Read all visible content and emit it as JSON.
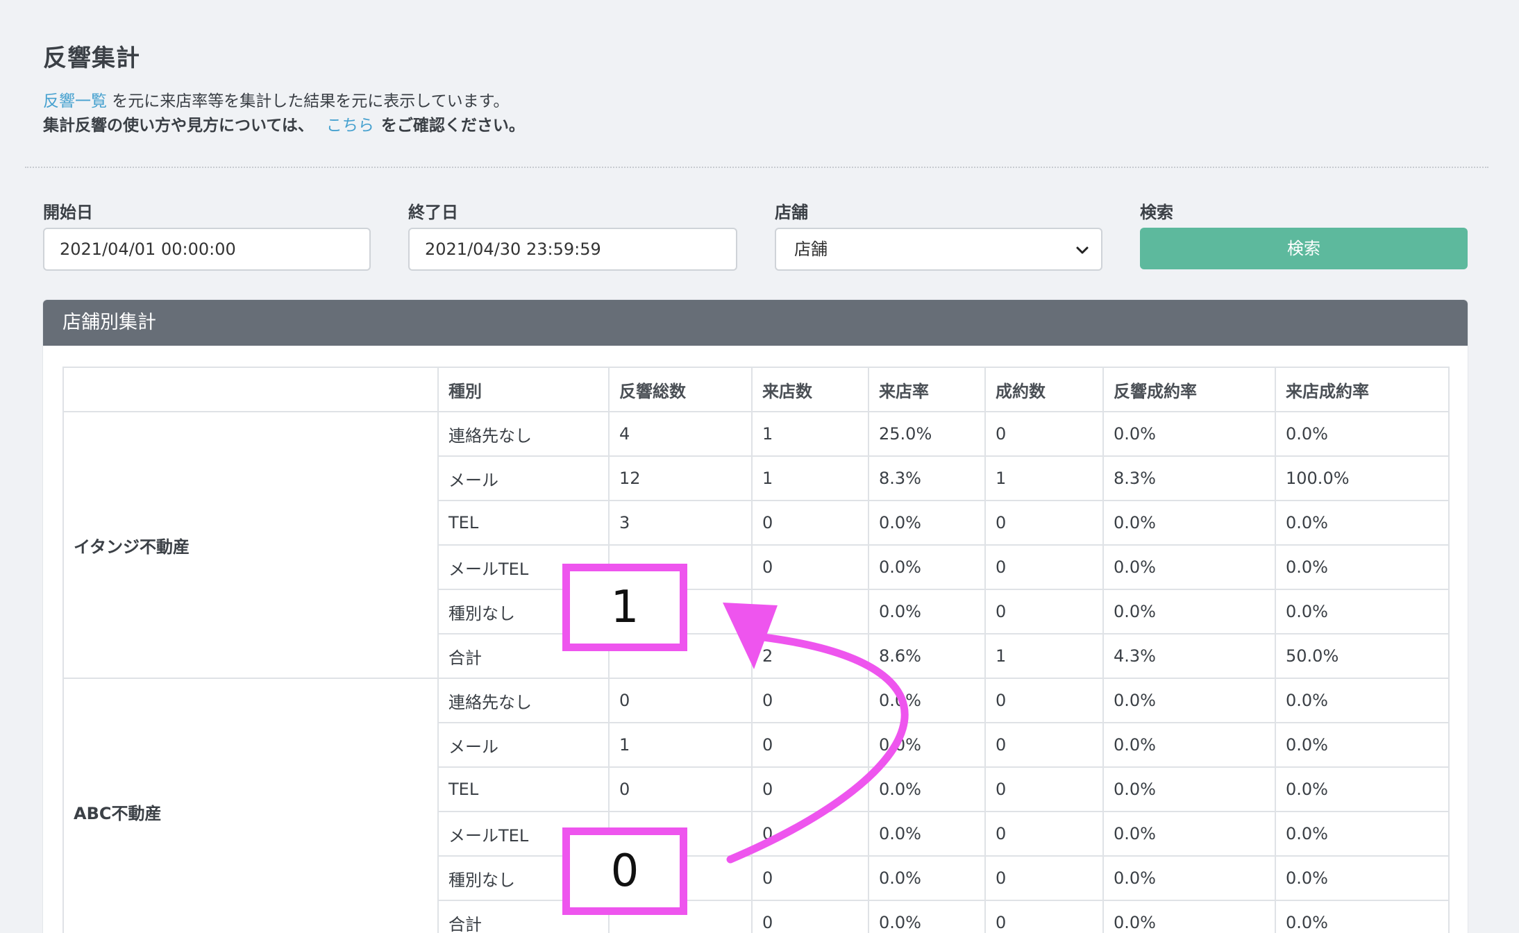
{
  "page_title": "反響集計",
  "description": {
    "link1": "反響一覧",
    "text1": " を元に来店率等を集計した結果を元に表示しています。",
    "text2_before": "集計反響の使い方や見方については、",
    "link2": "こちら",
    "text2_after": "をご確認ください。"
  },
  "filters": {
    "start_label": "開始日",
    "start_value": "2021/04/01 00:00:00",
    "end_label": "終了日",
    "end_value": "2021/04/30 23:59:59",
    "store_label": "店舗",
    "store_value": "店舗",
    "search_label": "検索",
    "search_button": "検索"
  },
  "card_title": "店舗別集計",
  "table": {
    "headers": [
      "",
      "種別",
      "反響総数",
      "来店数",
      "来店率",
      "成約数",
      "反響成約率",
      "来店成約率"
    ],
    "groups": [
      {
        "store": "イタンジ不動産",
        "rows": [
          [
            "連絡先なし",
            "4",
            "1",
            "25.0%",
            "0",
            "0.0%",
            "0.0%"
          ],
          [
            "メール",
            "12",
            "1",
            "8.3%",
            "1",
            "8.3%",
            "100.0%"
          ],
          [
            "TEL",
            "3",
            "0",
            "0.0%",
            "0",
            "0.0%",
            "0.0%"
          ],
          [
            "メールTEL",
            "",
            "0",
            "0.0%",
            "0",
            "0.0%",
            "0.0%"
          ],
          [
            "種別なし",
            "",
            "",
            "0.0%",
            "0",
            "0.0%",
            "0.0%"
          ],
          [
            "合計",
            "",
            "2",
            "8.6%",
            "1",
            "4.3%",
            "50.0%"
          ]
        ]
      },
      {
        "store": "ABC不動産",
        "rows": [
          [
            "連絡先なし",
            "0",
            "0",
            "0.0%",
            "0",
            "0.0%",
            "0.0%"
          ],
          [
            "メール",
            "1",
            "0",
            "0.0%",
            "0",
            "0.0%",
            "0.0%"
          ],
          [
            "TEL",
            "0",
            "0",
            "0.0%",
            "0",
            "0.0%",
            "0.0%"
          ],
          [
            "メールTEL",
            "",
            "0",
            "0.0%",
            "0",
            "0.0%",
            "0.0%"
          ],
          [
            "種別なし",
            "",
            "0",
            "0.0%",
            "0",
            "0.0%",
            "0.0%"
          ],
          [
            "合計",
            "",
            "0",
            "0.0%",
            "0",
            "0.0%",
            "0.0%"
          ]
        ]
      }
    ]
  },
  "annotations": {
    "box_top_value": "1",
    "box_bottom_value": "0",
    "color": "#ee55ee"
  }
}
